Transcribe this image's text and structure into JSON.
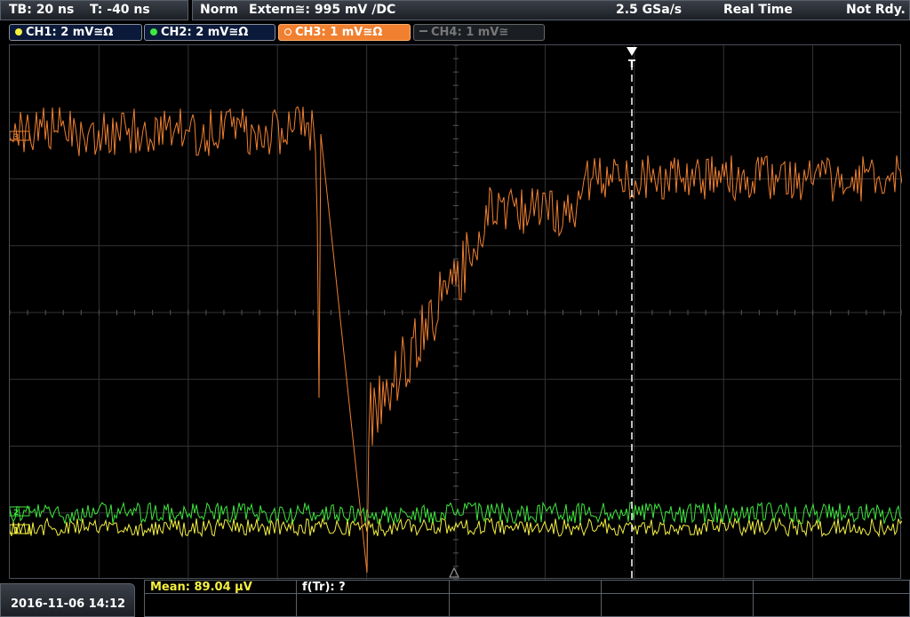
{
  "topbar": {
    "timebase": "TB: 20 ns",
    "trigger_offset": "T: -40 ns",
    "trigger_mode": "Norm",
    "trigger_source": "Extern≅: 995 mV ∕DC",
    "sample_rate": "2.5 GSa/s",
    "acq_mode": "Real Time",
    "status": "Not Rdy."
  },
  "channels": [
    {
      "label": "CH1: 2 mV≅Ω",
      "color": "#f4f040",
      "active": true
    },
    {
      "label": "CH2: 2 mV≅Ω",
      "color": "#3ee63e",
      "active": true
    },
    {
      "label": "CH3: 1 mV≅Ω",
      "color": "#f08030",
      "active": true,
      "selected": true
    },
    {
      "label": "CH4: 1 mV≅",
      "color": "#777777",
      "active": false
    }
  ],
  "markers": {
    "trigger": "T",
    "ch3": "3",
    "ch2": "2",
    "ch1": "1"
  },
  "bottom": {
    "datetime": "2016-11-06 14:12",
    "mean": "Mean: 89.04 µV",
    "ftr": "f(Tr): ?"
  },
  "colors": {
    "ch1": "#f4f040",
    "ch2": "#3ee63e",
    "ch3": "#f08030",
    "grid": "#3a3a3a",
    "trigger_line": "#ffffff"
  }
}
